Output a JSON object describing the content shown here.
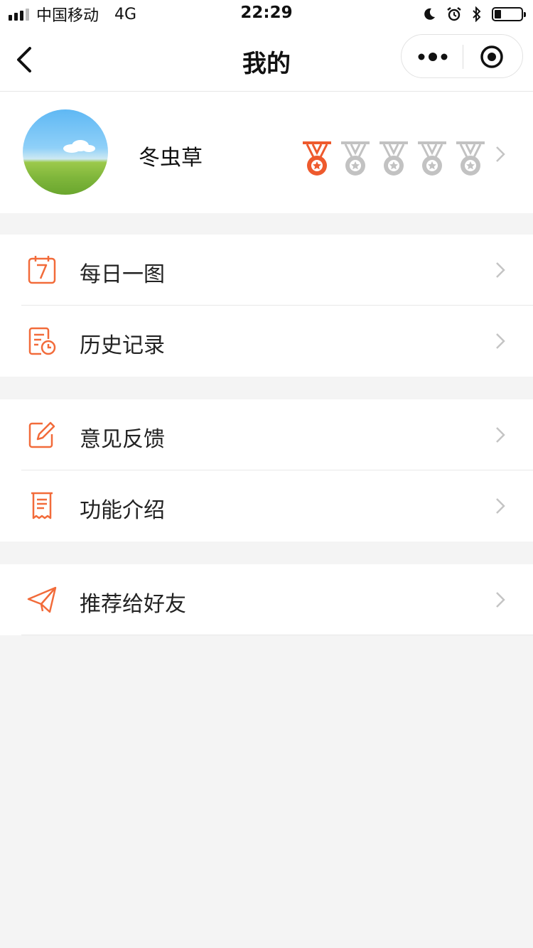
{
  "status_bar": {
    "carrier": "中国移动",
    "network": "4G",
    "time": "22:29"
  },
  "nav": {
    "title": "我的"
  },
  "profile": {
    "nickname": "冬虫草",
    "medals_earned": 1,
    "medals_total": 5
  },
  "menu": {
    "group1": [
      {
        "label": "每日一图",
        "icon": "calendar-icon"
      },
      {
        "label": "历史记录",
        "icon": "history-icon"
      }
    ],
    "group2": [
      {
        "label": "意见反馈",
        "icon": "edit-icon"
      },
      {
        "label": "功能介绍",
        "icon": "receipt-icon"
      }
    ],
    "group3": [
      {
        "label": "推荐给好友",
        "icon": "paper-plane-icon"
      }
    ]
  },
  "colors": {
    "accent": "#f26b3a",
    "medal_active": "#ee5a2d",
    "medal_inactive": "#c2c2c2",
    "background": "#f4f4f4"
  }
}
